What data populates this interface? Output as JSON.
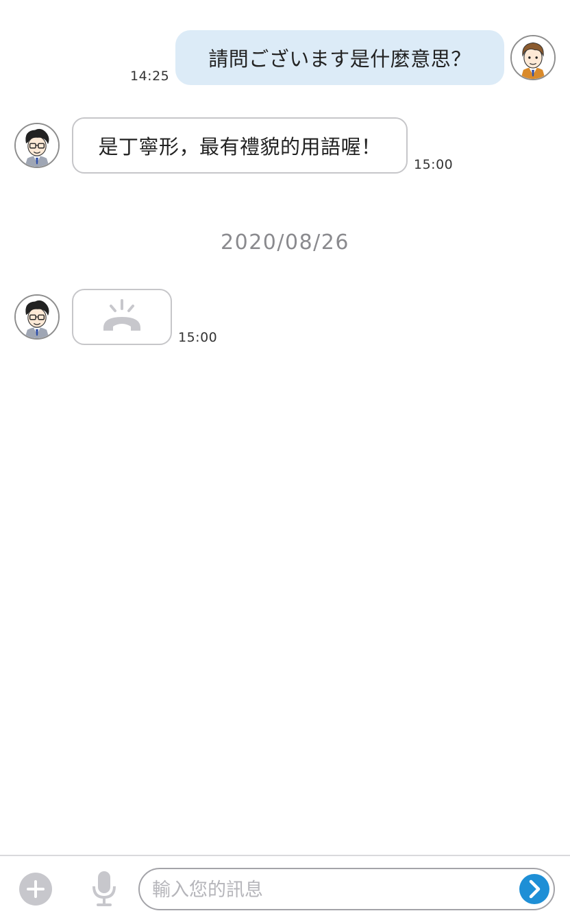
{
  "conversation": {
    "messages": [
      {
        "sender": "me",
        "text": "請問ございます是什麼意思？",
        "time": "14:25"
      },
      {
        "sender": "tutor",
        "text": "是丁寧形，最有禮貌的用語喔！",
        "time": "15:00"
      }
    ],
    "date_separator": "2020/08/26",
    "call_message": {
      "sender": "tutor",
      "icon": "missed-call-icon",
      "time": "15:00"
    }
  },
  "composer": {
    "placeholder": "輸入您的訊息",
    "value": "",
    "add_icon": "plus-icon",
    "voice_icon": "microphone-icon",
    "send_icon": "chevron-right-icon"
  },
  "colors": {
    "outgoing_bubble": "#dcebf7",
    "incoming_border": "#c6c6c9",
    "send_button": "#1e8fd6",
    "muted_gray": "#c7c7cc"
  }
}
